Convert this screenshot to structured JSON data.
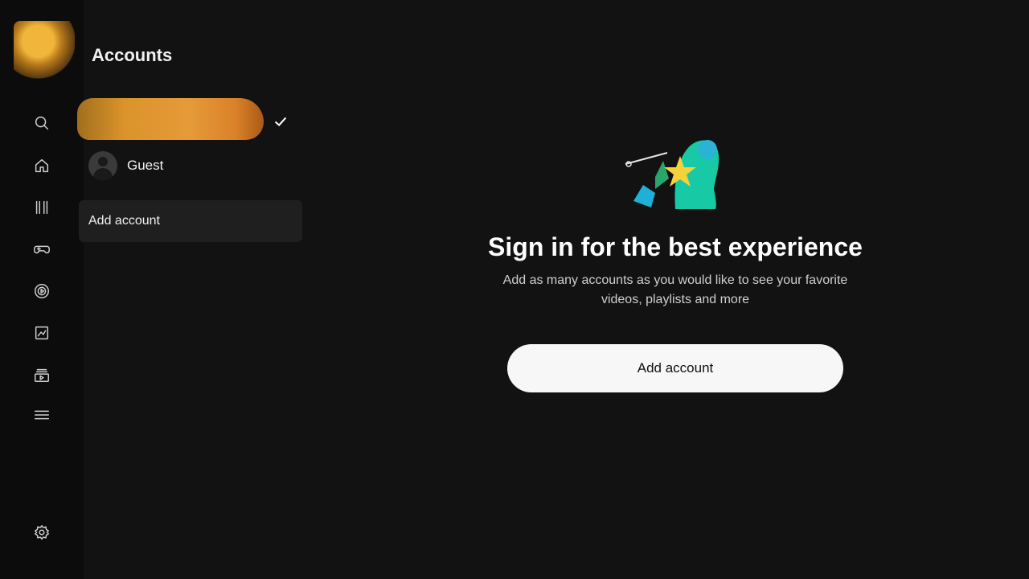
{
  "header": {
    "title": "Accounts"
  },
  "sidebar": {
    "icons": [
      "search-icon",
      "home-icon",
      "shorts-icon",
      "gaming-icon",
      "music-icon",
      "library-icon",
      "subscriptions-icon",
      "menu-icon",
      "settings-icon"
    ]
  },
  "accounts": {
    "current": {
      "selected": true
    },
    "guest": {
      "name": "Guest"
    },
    "add_label": "Add account"
  },
  "main": {
    "headline": "Sign in for the best experience",
    "subtext": "Add as many accounts as you would like to see your favorite videos, playlists and more",
    "cta_label": "Add account"
  },
  "colors": {
    "background": "#121212",
    "rail": "#0c0c0c",
    "cta_bg": "#f7f7f7",
    "accent_avatar": "#e59a2c"
  }
}
